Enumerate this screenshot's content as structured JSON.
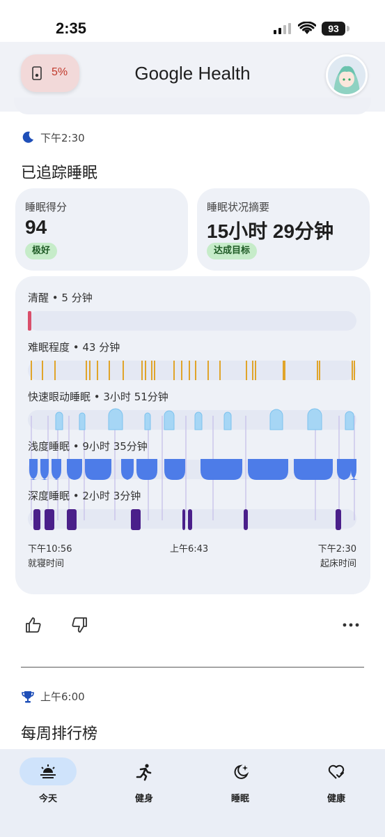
{
  "status_bar": {
    "time": "2:35",
    "battery": "93"
  },
  "header": {
    "battery_chip_pct": "5%",
    "title": "Google Health"
  },
  "sleep": {
    "time": "下午2:30",
    "title": "已追踪睡眠",
    "score_card": {
      "label": "睡眠得分",
      "value": "94",
      "badge": "极好"
    },
    "summary_card": {
      "label": "睡眠状况摘要",
      "value": "15小时 29分钟",
      "badge": "达成目标"
    },
    "stages": {
      "awake": {
        "label": "清醒 • 5 分钟"
      },
      "restless": {
        "label": "难眠程度 • 43 分钟"
      },
      "rem": {
        "label": "快速眼动睡眠 • 3小时 51分钟"
      },
      "light": {
        "label": "浅度睡眠 • 9小时 35分钟"
      },
      "deep": {
        "label": "深度睡眠 • 2小时 3分钟"
      }
    },
    "axis": {
      "start_time": "下午10:56",
      "start_label": "就寝时间",
      "mid_time": "上午6:43",
      "end_time": "下午2:30",
      "end_label": "起床时间"
    },
    "colors": {
      "awake": "#d94f6b",
      "restless": "#e0a42a",
      "rem": "#a6d6f5",
      "light": "#4d7ce8",
      "deep": "#4a1f8a",
      "track": "#e4e8f3"
    }
  },
  "weekly": {
    "time": "上午6:00",
    "title": "每周排行榜"
  },
  "nav": {
    "items": [
      {
        "label": "今天",
        "icon": "today-icon",
        "active": true
      },
      {
        "label": "健身",
        "icon": "running-icon",
        "active": false
      },
      {
        "label": "睡眠",
        "icon": "moon-sparkle-icon",
        "active": false
      },
      {
        "label": "健康",
        "icon": "heart-check-icon",
        "active": false
      }
    ]
  }
}
